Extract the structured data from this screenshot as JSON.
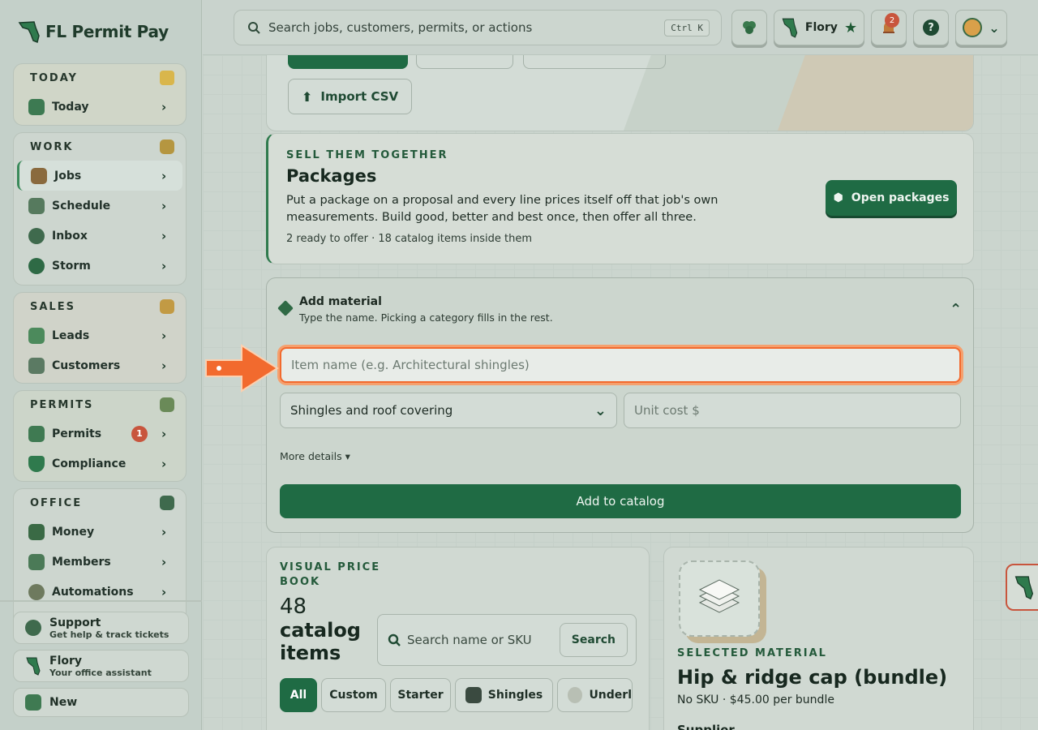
{
  "brand": {
    "name": "FL Permit Pay"
  },
  "sidebar": {
    "groups": [
      {
        "title": "TODAY",
        "items": [
          {
            "label": "Today"
          }
        ]
      },
      {
        "title": "WORK",
        "items": [
          {
            "label": "Jobs"
          },
          {
            "label": "Schedule"
          },
          {
            "label": "Inbox"
          },
          {
            "label": "Storm"
          }
        ]
      },
      {
        "title": "SALES",
        "items": [
          {
            "label": "Leads"
          },
          {
            "label": "Customers"
          }
        ]
      },
      {
        "title": "PERMITS",
        "items": [
          {
            "label": "Permits",
            "badge": "1"
          },
          {
            "label": "Compliance"
          }
        ]
      },
      {
        "title": "OFFICE",
        "items": [
          {
            "label": "Money"
          },
          {
            "label": "Members"
          },
          {
            "label": "Automations"
          }
        ]
      }
    ],
    "footer": [
      {
        "title": "Support",
        "subtitle": "Get help & track tickets"
      },
      {
        "title": "Flory",
        "subtitle": "Your office assistant"
      },
      {
        "title": "New"
      }
    ]
  },
  "topbar": {
    "search_placeholder": "Search jobs, customers, permits, or actions",
    "shortcut": "Ctrl K",
    "assistant_name": "Flory",
    "notifications_count": "2",
    "help_glyph": "?"
  },
  "main": {
    "import_csv_label": "Import CSV",
    "packages": {
      "eyebrow": "SELL THEM TOGETHER",
      "title": "Packages",
      "description": "Put a package on a proposal and every line prices itself off that job's own measurements. Build good, better and best once, then offer all three.",
      "meta": "2 ready to offer · 18 catalog items inside them",
      "button_label": "Open packages"
    },
    "add_material": {
      "title": "Add material",
      "subtitle": "Type the name. Picking a category fills in the rest.",
      "item_name_placeholder": "Item name (e.g. Architectural shingles)",
      "category_value": "Shingles and roof covering",
      "unit_cost_placeholder": "Unit cost $",
      "more_details_label": "More details ▾",
      "submit_label": "Add to catalog"
    },
    "price_book": {
      "eyebrow_line1": "VISUAL PRICE",
      "eyebrow_line2": "BOOK",
      "count": "48",
      "count_line1": "catalog",
      "count_line2": "items",
      "search_placeholder": "Search name or SKU",
      "search_button": "Search",
      "filters": [
        "All",
        "Custom",
        "Starter",
        "Shingles",
        "Underl"
      ]
    },
    "selected_material": {
      "eyebrow": "SELECTED MATERIAL",
      "title": "Hip & ridge cap (bundle)",
      "sku_price": "No SKU · $45.00 per bundle",
      "supplier_label": "Supplier"
    }
  },
  "colors": {
    "accent_green": "#1f6b44",
    "highlight_orange": "#f26a2e",
    "badge_red": "#c8553d"
  }
}
